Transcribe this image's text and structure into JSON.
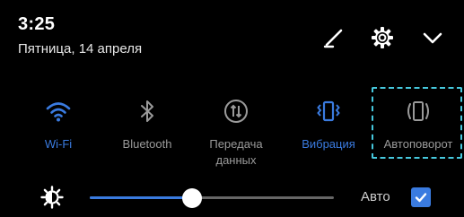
{
  "header": {
    "time": "3:25",
    "date": "Пятница, 14 апреля",
    "icons": [
      "edit-icon",
      "gear-icon",
      "chevron-down-icon"
    ]
  },
  "toggles": [
    {
      "id": "wifi",
      "label": "Wi-Fi",
      "icon": "wifi-icon",
      "active": true
    },
    {
      "id": "bluetooth",
      "label": "Bluetooth",
      "icon": "bluetooth-icon",
      "active": false
    },
    {
      "id": "mobile-data",
      "label": "Передача данных",
      "icon": "mobile-data-icon",
      "active": false
    },
    {
      "id": "vibration",
      "label": "Вибрация",
      "icon": "vibration-icon",
      "active": true
    },
    {
      "id": "auto-rotate",
      "label": "Автоповорот",
      "icon": "rotate-icon",
      "active": false
    }
  ],
  "brightness": {
    "level_percent": 42,
    "auto_label": "Авто",
    "auto_checked": true
  },
  "colors": {
    "accent": "#3a7be0",
    "highlight_dash": "#46c8dd",
    "inactive": "#9a9a9a",
    "background": "#000000"
  }
}
